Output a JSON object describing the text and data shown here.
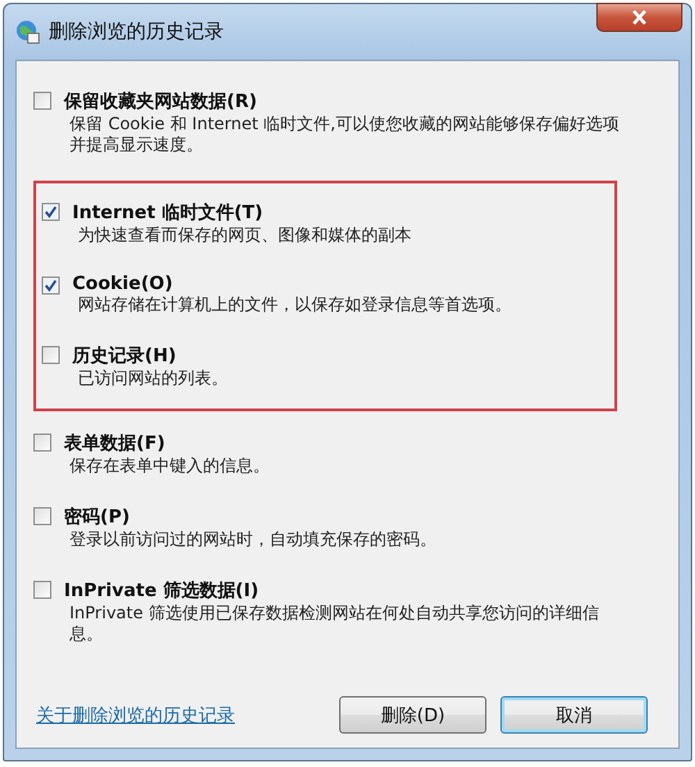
{
  "window": {
    "title": "删除浏览的历史记录"
  },
  "options": [
    {
      "label": "保留收藏夹网站数据(R)",
      "description": "保留 Cookie 和 Internet 临时文件,可以使您收藏的网站能够保存偏好选项并提高显示速度。",
      "checked": false,
      "highlighted": false
    },
    {
      "label": "Internet 临时文件(T)",
      "description": "为快速查看而保存的网页、图像和媒体的副本",
      "checked": true,
      "highlighted": true
    },
    {
      "label": "Cookie(O)",
      "description": "网站存储在计算机上的文件，以保存如登录信息等首选项。",
      "checked": true,
      "highlighted": true
    },
    {
      "label": "历史记录(H)",
      "description": "已访问网站的列表。",
      "checked": false,
      "highlighted": true
    },
    {
      "label": "表单数据(F)",
      "description": "保存在表单中键入的信息。",
      "checked": false,
      "highlighted": false
    },
    {
      "label": "密码(P)",
      "description": "登录以前访问过的网站时，自动填充保存的密码。",
      "checked": false,
      "highlighted": false
    },
    {
      "label": "InPrivate 筛选数据(I)",
      "description": "InPrivate 筛选使用已保存数据检测网站在何处自动共享您访问的详细信息。",
      "checked": false,
      "highlighted": false
    }
  ],
  "footer": {
    "link": "关于删除浏览的历史记录",
    "buttons": [
      {
        "label": "删除(D)",
        "default": false
      },
      {
        "label": "取消",
        "default": true
      }
    ]
  }
}
